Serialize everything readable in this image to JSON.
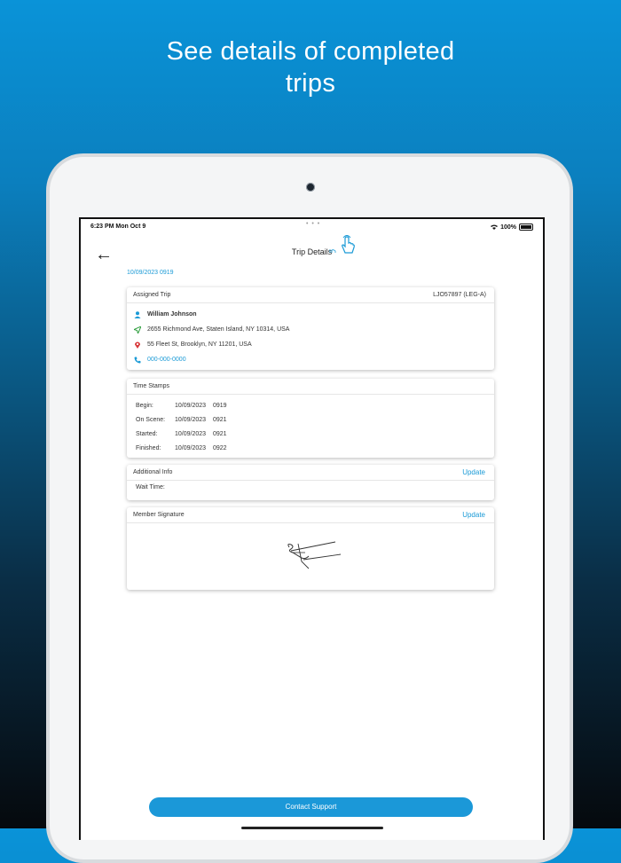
{
  "headline": {
    "line1": "See details of completed",
    "line2": "trips"
  },
  "status_bar": {
    "time": "6:23 PM  Mon Oct 9",
    "dots": "• • •",
    "battery": "100%"
  },
  "header": {
    "title": "Trip Details"
  },
  "trip_datetime": "10/09/2023 0919",
  "assigned_trip": {
    "heading": "Assigned Trip",
    "trip_id": "LJO57897 (LEG-A)",
    "member_name": "William Johnson",
    "pickup_address": "2655 Richmond Ave, Staten Island, NY 10314, USA",
    "dropoff_address": "55 Fleet St, Brooklyn, NY 11201, USA",
    "phone": "000-000-0000"
  },
  "time_stamps": {
    "heading": "Time Stamps",
    "rows": [
      {
        "label": "Begin:",
        "date": "10/09/2023",
        "time": "0919"
      },
      {
        "label": "On Scene:",
        "date": "10/09/2023",
        "time": "0921"
      },
      {
        "label": "Started:",
        "date": "10/09/2023",
        "time": "0921"
      },
      {
        "label": "Finished:",
        "date": "10/09/2023",
        "time": "0922"
      }
    ]
  },
  "additional_info": {
    "heading": "Additional Info",
    "update_label": "Update",
    "wait_time_label": "Wait Time:",
    "wait_time_value": ""
  },
  "member_signature": {
    "heading": "Member Signature",
    "update_label": "Update"
  },
  "contact_support": {
    "label": "Contact Support"
  },
  "colors": {
    "accent": "#1a9ad6",
    "person_icon": "#1a9ad6",
    "pickup_icon": "#2e9e3e",
    "dropoff_icon": "#d8383a"
  }
}
